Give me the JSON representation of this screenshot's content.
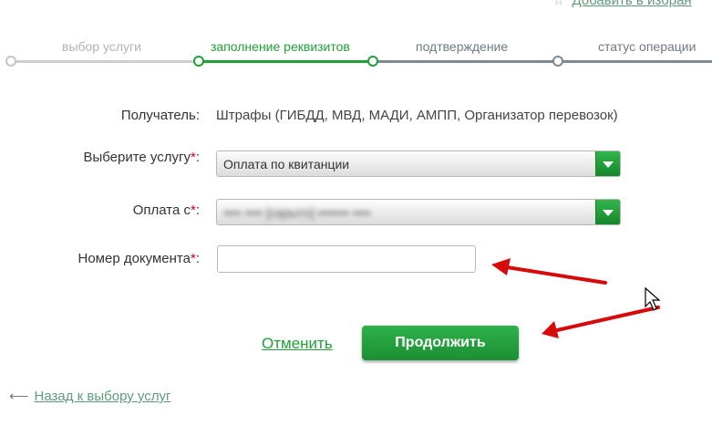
{
  "top_link": {
    "icon": "star-icon",
    "text": "Добавить в избран"
  },
  "steps": [
    {
      "label": "выбор услуги",
      "state": "done"
    },
    {
      "label": "заполнение реквизитов",
      "state": "active"
    },
    {
      "label": "подтверждение",
      "state": "todo"
    },
    {
      "label": "статус операции",
      "state": "todo"
    }
  ],
  "form": {
    "recipient_label": "Получатель:",
    "recipient_value": "Штрафы (ГИБДД, МВД, МАДИ, АМПП, Организатор перевозок)",
    "service_label": "Выберите услугу",
    "service_value": "Оплата по квитанции",
    "pay_from_label": "Оплата с",
    "pay_from_value": "•••• •••• [скрыто] ••••••• ••••",
    "doc_number_label": "Номер документа",
    "doc_number_value": "",
    "required_mark": "*",
    "colon": ":"
  },
  "actions": {
    "cancel": "Отменить",
    "continue": "Продолжить"
  },
  "back_link": {
    "arrow": "⟵",
    "text": "Назад к выбору услуг"
  },
  "colors": {
    "accent": "#21a038",
    "annotation_arrow": "#d60a0a",
    "link": "#5f9a7b"
  }
}
